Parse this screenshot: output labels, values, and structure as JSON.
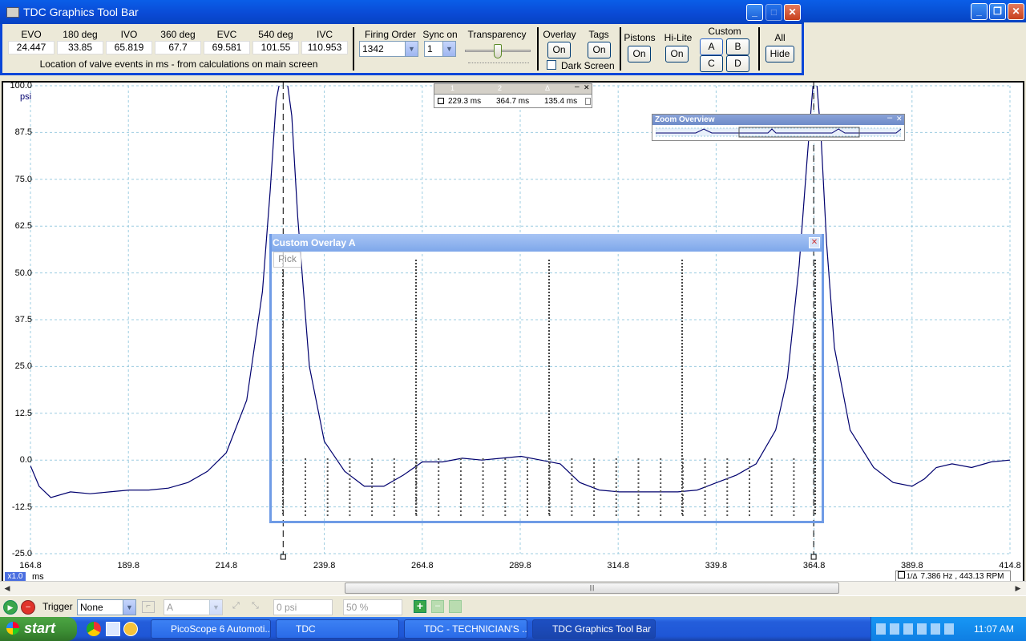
{
  "tdc_window": {
    "title": "TDC Graphics Tool Bar",
    "valve_events": [
      {
        "label": "EVO",
        "value": "24.447"
      },
      {
        "label": "180 deg",
        "value": "33.85"
      },
      {
        "label": "IVO",
        "value": "65.819"
      },
      {
        "label": "360 deg",
        "value": "67.7"
      },
      {
        "label": "EVC",
        "value": "69.581"
      },
      {
        "label": "540 deg",
        "value": "101.55"
      },
      {
        "label": "IVC",
        "value": "110.953"
      }
    ],
    "valve_note": "Location of valve events in ms - from calculations on main screen",
    "firing_order_label": "Firing Order",
    "firing_order_value": "1342",
    "sync_on_label": "Sync on",
    "sync_on_value": "1",
    "transparency_label": "Transparency",
    "overlay_label": "Overlay",
    "overlay_button": "On",
    "tags_label": "Tags",
    "tags_button": "On",
    "dark_screen_label": "Dark Screen",
    "pistons_label": "Pistons",
    "pistons_button": "On",
    "hilite_label": "Hi-Lite",
    "hilite_button": "On",
    "custom_label": "Custom",
    "custom_buttons": [
      "A",
      "B",
      "C",
      "D"
    ],
    "all_label": "All",
    "all_button": "Hide"
  },
  "scope": {
    "y_unit": "psi",
    "y_ticks": [
      "100.0",
      "87.5",
      "75.0",
      "62.5",
      "50.0",
      "37.5",
      "25.0",
      "12.5",
      "0.0",
      "-12.5",
      "-25.0"
    ],
    "x_ticks": [
      "164.8",
      "189.8",
      "214.8",
      "239.8",
      "264.8",
      "289.8",
      "314.8",
      "339.8",
      "364.8",
      "389.8",
      "414.8"
    ],
    "x_unit": "ms",
    "zoom_badge": "x1.0",
    "freq_readout": "7.386 Hz , 443.13 RPM"
  },
  "chart_data": {
    "type": "line",
    "xlabel": "ms",
    "ylabel": "psi",
    "xlim": [
      164.8,
      414.8
    ],
    "ylim": [
      -25.0,
      100.0
    ],
    "grid": true,
    "cursors": [
      229.3,
      364.7
    ],
    "series": [
      {
        "x": [
          164.8,
          167,
          170,
          175,
          180,
          185,
          190,
          195,
          200,
          205,
          210,
          214.8,
          220,
          224,
          226,
          227.5,
          228.6,
          229.3,
          230.2,
          231.5,
          233,
          236,
          239.8,
          245,
          250,
          255,
          260,
          264.8,
          270,
          275,
          280,
          285,
          290,
          295,
          300,
          305,
          310,
          315,
          320,
          325,
          330,
          335,
          340,
          345,
          350,
          355,
          358,
          361,
          363,
          364.2,
          364.7,
          365.4,
          366.6,
          368,
          370,
          374,
          380,
          385,
          389.8,
          393,
          396,
          400,
          405,
          410,
          414.8
        ],
        "y": [
          -1.5,
          -7,
          -10,
          -8.5,
          -9,
          -8.5,
          -8,
          -8,
          -7.5,
          -6,
          -3,
          2,
          16,
          45,
          72,
          96,
          105,
          108,
          106,
          92,
          65,
          25,
          5,
          -3,
          -7,
          -7,
          -4,
          -0.5,
          -0.5,
          0.5,
          0,
          0.5,
          1,
          0,
          -1,
          -6,
          -8,
          -8.5,
          -8.5,
          -8.5,
          -8.5,
          -8,
          -6,
          -4,
          -1,
          8,
          22,
          52,
          80,
          96,
          106,
          103,
          86,
          58,
          30,
          8,
          -2,
          -6,
          -7,
          -5,
          -2,
          -1,
          -2,
          -0.5,
          0
        ]
      }
    ]
  },
  "cursor_table": {
    "headers": [
      "1",
      "2",
      "Δ"
    ],
    "values": [
      "229.3 ms",
      "364.7 ms",
      "135.4 ms"
    ]
  },
  "zoom_overview": {
    "title": "Zoom Overview"
  },
  "custom_overlay": {
    "title": "Custom Overlay A",
    "pick_label": "Pick"
  },
  "bottom_bar": {
    "trigger_label": "Trigger",
    "trigger_mode": "None",
    "channel": "A",
    "threshold": "0 psi",
    "percent": "50 %"
  },
  "taskbar": {
    "start_label": "start",
    "tasks": [
      "PicoScope 6 Automoti...",
      "TDC",
      "TDC - TECHNICIAN'S ...",
      "TDC Graphics Tool Bar"
    ],
    "clock": "11:07 AM"
  },
  "colors": {
    "trace": "#00006e",
    "overlay_trace": "#6e6ec8",
    "grid": "#9ccce0",
    "xp_blue": "#0a5ee8"
  }
}
